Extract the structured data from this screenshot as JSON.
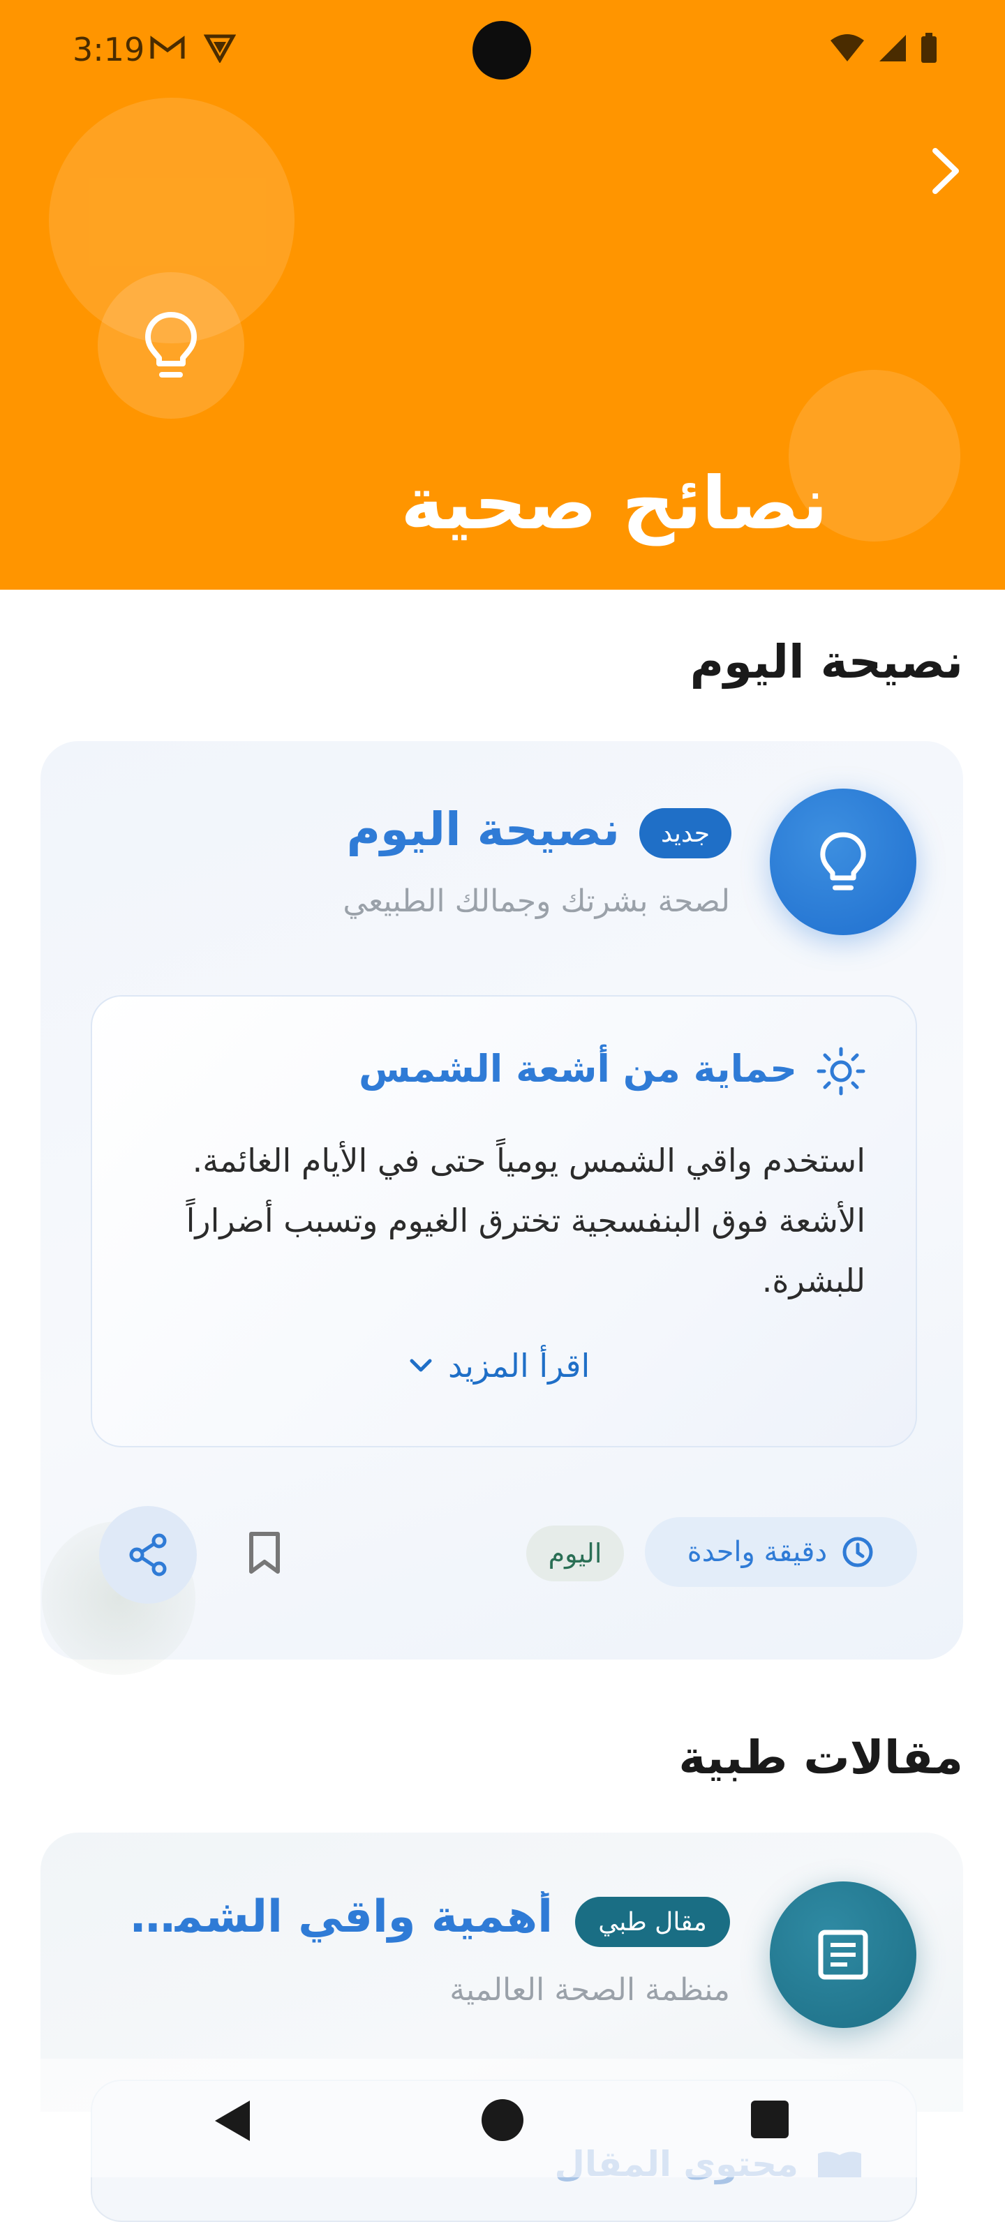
{
  "status_bar": {
    "time": "3:19"
  },
  "header": {
    "title": "نصائح صحية"
  },
  "tip_section": {
    "title": "نصيحة اليوم",
    "card": {
      "badge": "جديد",
      "title": "نصيحة اليوم",
      "subtitle": "لصحة بشرتك وجمالك الطبيعي",
      "tip": {
        "title": "حماية من أشعة الشمس",
        "body": "استخدم واقي الشمس يومياً حتى في الأيام الغائمة. الأشعة فوق البنفسجية تخترق الغيوم وتسبب أضراراً للبشرة.",
        "read_more": "اقرأ المزيد"
      },
      "read_time": "دقيقة واحدة",
      "date_tag": "اليوم"
    }
  },
  "articles_section": {
    "title": "مقالات طبية",
    "article": {
      "badge": "مقال طبي",
      "title": "أهمية واقي الشمس ...",
      "source": "منظمة الصحة العالمية",
      "content_label": "محتوى المقال"
    }
  },
  "colors": {
    "header_bg": "#ff9500",
    "accent_blue": "#2f7bd6",
    "badge_blue": "#1f6fc7",
    "badge_teal": "#1a6e84"
  },
  "icons": {
    "header_icon": "lightbulb-icon",
    "tip_icon": "lightbulb-icon",
    "tip_title_icon": "sun-icon",
    "read_time_icon": "clock-icon",
    "article_icon": "article-icon"
  }
}
